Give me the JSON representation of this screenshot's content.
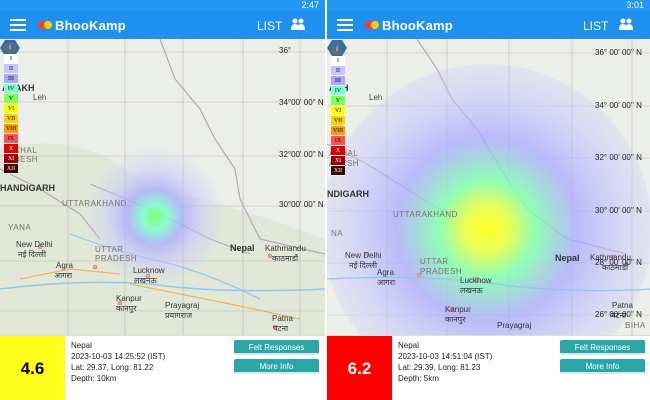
{
  "screens": [
    {
      "status_time": "2:47",
      "app_title": "BhooKamp",
      "list_label": "LIST",
      "legend_levels": [
        "I",
        "II",
        "III",
        "IV",
        "V",
        "VI",
        "VII",
        "VIII",
        "IX",
        "X",
        "XI",
        "XII"
      ],
      "legend_colors": [
        "#ffffff",
        "#c6c6ff",
        "#a9a9ff",
        "#7cffd0",
        "#80ff50",
        "#ffff00",
        "#ffd000",
        "#ff9900",
        "#ff5050",
        "#e00000",
        "#a00000",
        "#400000"
      ],
      "map_labels": {
        "ladakh": "ADAKH",
        "leh": "Leh",
        "himachal": "ACHAL",
        "pradesh": "ADESH",
        "chandigarh": "HANDIGARH",
        "uttarakhand": "UTTARAKHAND",
        "haryana": "YANA",
        "new_delhi": "New Delhi",
        "new_delhi_hi": "नई दिल्ली",
        "agra": "Agra",
        "agra_hi": "आगरा",
        "uttar": "UTTAR",
        "up_pradesh": "PRADESH",
        "lucknow": "Lucknow",
        "lucknow_hi": "लखनऊ",
        "kanpur": "Kanpur",
        "kanpur_hi": "कानपुर",
        "prayagraj": "Prayagraj",
        "prayagraj_hi": "प्रयागराज",
        "nepal": "Nepal",
        "kathmandu": "Kathmandu",
        "kathmandu_hi": "काठमाडौं",
        "patna": "Patna",
        "patna_hi": "पटना",
        "lat36": "36°",
        "lat34": "34°00' 00'' N",
        "lat32": "32°00' 00'' N",
        "lat30": "30°00' 00'' N"
      },
      "event": {
        "magnitude": "4.6",
        "magnitude_color": "#ffff1a",
        "magnitude_text_color": "#000000",
        "place": "Nepal",
        "time": "2023-10-03 14:25:52 (IST)",
        "latlong": "Lat: 29.37, Long: 81.22",
        "depth": "Depth: 10km"
      },
      "felt_label": "Felt Responses",
      "more_label": "More Info"
    },
    {
      "status_time": "3:01",
      "app_title": "BhooKamp",
      "list_label": "LIST",
      "legend_levels": [
        "I",
        "II",
        "III",
        "IV",
        "V",
        "VI",
        "VII",
        "VIII",
        "IX",
        "X",
        "XI",
        "XII"
      ],
      "legend_colors": [
        "#ffffff",
        "#c6c6ff",
        "#a9a9ff",
        "#7cffd0",
        "#80ff50",
        "#ffff00",
        "#ffd000",
        "#ff9900",
        "#ff5050",
        "#e00000",
        "#a00000",
        "#400000"
      ],
      "map_labels": {
        "ladakh": "AKH",
        "leh": "Leh",
        "himachal": "ACHAL",
        "pradesh": "ADESH",
        "chandigarh": "NDIGARH",
        "uttarakhand": "UTTARAKHAND",
        "haryana": "NA",
        "new_delhi": "New Delhi",
        "new_delhi_hi": "नई दिल्ली",
        "agra": "Agra",
        "agra_hi": "आगरा",
        "uttar": "UTTAR",
        "up_pradesh": "PRADESH",
        "lucknow": "Lucknow",
        "lucknow_hi": "लखनऊ",
        "kanpur": "Kanpur",
        "kanpur_hi": "कानपुर",
        "prayagraj": "Prayagraj",
        "prayagraj_hi": "प्रयागराज",
        "nepal": "Nepal",
        "kathmandu": "Kathmandu",
        "kathmandu_hi": "काठमाडौं",
        "patna": "Patna",
        "patna_hi": "पटना",
        "bihar": "BIHA",
        "lat36": "36° 00' 00'' N",
        "lat34": "34° 00' 00'' N",
        "lat32": "32° 00' 00'' N",
        "lat30": "30° 00' 00'' N",
        "lat28": "28° 00' 00'' N",
        "lat26": "26° 00' 00'' N"
      },
      "event": {
        "magnitude": "6.2",
        "magnitude_color": "#ff0000",
        "magnitude_text_color": "#ffffff",
        "place": "Nepal",
        "time": "2023-10-03 14:51:04 (IST)",
        "latlong": "Lat: 29.39, Long: 81.23",
        "depth": "Depth: 5km"
      },
      "felt_label": "Felt Responses",
      "more_label": "More Info"
    }
  ]
}
